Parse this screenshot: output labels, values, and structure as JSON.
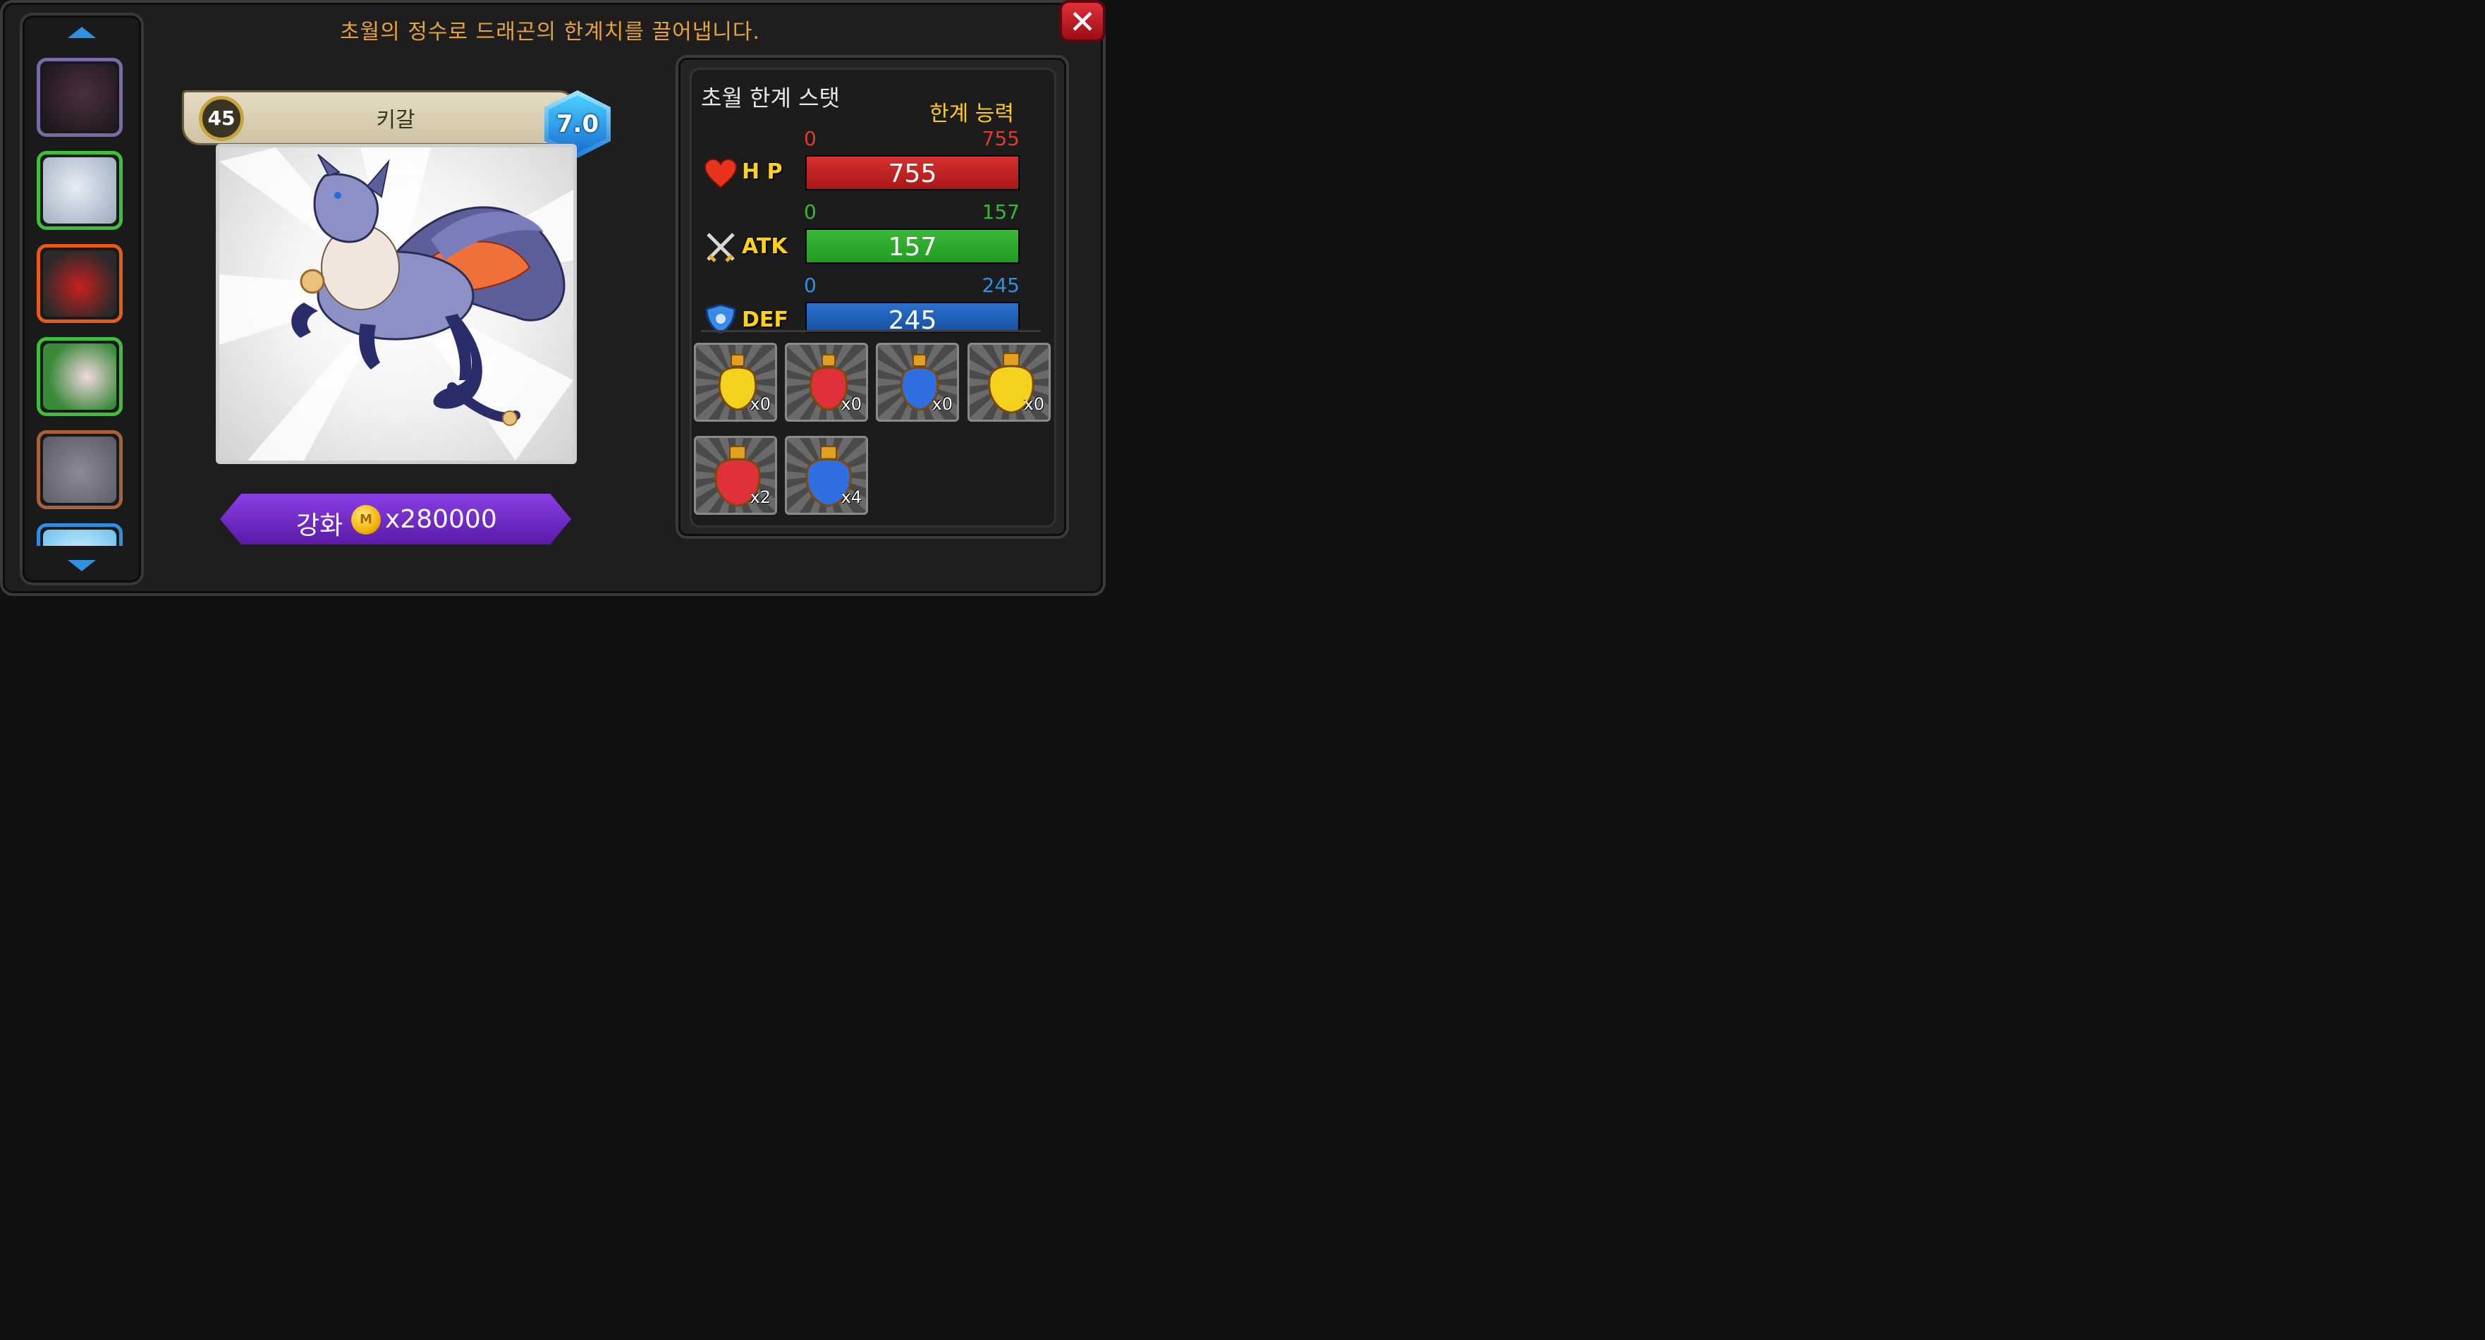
{
  "header": {
    "subtitle": "초월의 정수로 드래곤의 한계치를 끌어냅니다."
  },
  "dragon": {
    "level": "45",
    "name": "키갈",
    "grade": "7.0"
  },
  "enhance": {
    "label": "강화",
    "coin_symbol": "M",
    "cost": "x280000"
  },
  "stats": {
    "title": "초월 한계 스탯",
    "limit_title": "한계 능력",
    "items": [
      {
        "label": "H P",
        "min": "0",
        "max": "755",
        "value": "755",
        "color": "#c81e1e",
        "range_color": "#e03a2a"
      },
      {
        "label": "ATK",
        "min": "0",
        "max": "157",
        "value": "157",
        "color": "#2fa82a",
        "range_color": "#38b830"
      },
      {
        "label": "DEF",
        "min": "0",
        "max": "245",
        "value": "245",
        "color": "#1a5fbe",
        "range_color": "#2f8fe0"
      }
    ]
  },
  "essences": [
    {
      "color": "#f2d21e",
      "qty": "x0"
    },
    {
      "color": "#e0303a",
      "qty": "x0"
    },
    {
      "color": "#2f6fe0",
      "qty": "x0"
    },
    {
      "color": "#f2d21e",
      "qty": "x0"
    },
    {
      "color": "#e0303a",
      "qty": "x2"
    },
    {
      "color": "#2f6fe0",
      "qty": "x4"
    }
  ],
  "dragon_list": [
    {
      "border": "#7a6aa8",
      "bg": "#3a2f3a"
    },
    {
      "border": "#3fc03a",
      "bg": "#b9c6d6"
    },
    {
      "border": "#e85a1a",
      "bg": "#6a2a2a"
    },
    {
      "border": "#3fc03a",
      "bg": "#3a8a3a"
    },
    {
      "border": "#a8623a",
      "bg": "#8a8a9a"
    },
    {
      "border": "#2f8fe0",
      "bg": "#8ad0f0"
    }
  ]
}
